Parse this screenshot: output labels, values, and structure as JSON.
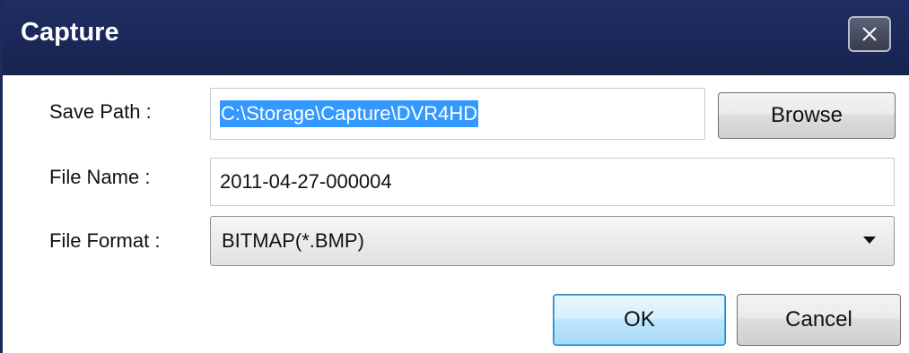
{
  "window": {
    "title": "Capture",
    "close_icon": "close-icon"
  },
  "form": {
    "save_path": {
      "label": "Save Path :",
      "value": "C:\\Storage\\Capture\\DVR4HD"
    },
    "file_name": {
      "label": "File Name :",
      "value": "2011-04-27-000004"
    },
    "file_format": {
      "label": "File Format :",
      "selected": "BITMAP(*.BMP)"
    }
  },
  "buttons": {
    "browse": "Browse",
    "ok": "OK",
    "cancel": "Cancel"
  },
  "colors": {
    "titlebar": "#1f2d63",
    "selection": "#3399ff",
    "ok_border": "#3c7fb1"
  }
}
